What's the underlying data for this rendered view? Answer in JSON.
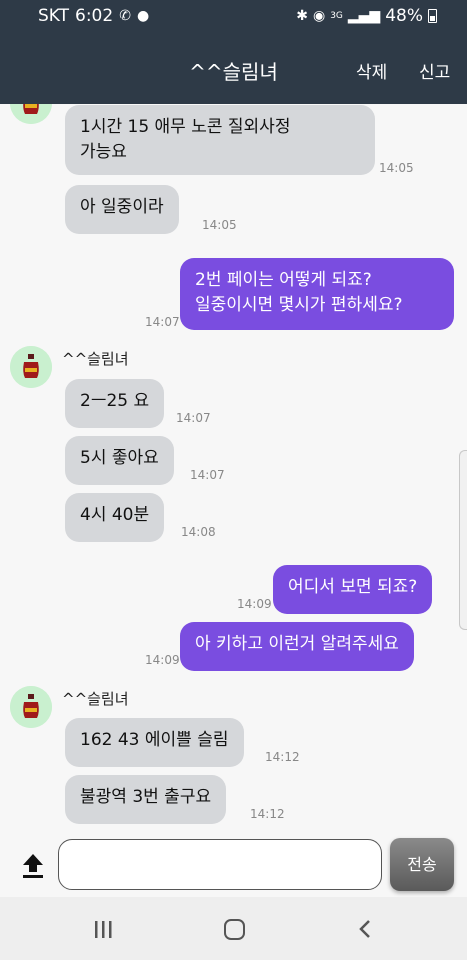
{
  "status_bar": {
    "carrier": "SKT",
    "time": "6:02",
    "network": "3G",
    "battery": "48%"
  },
  "header": {
    "title": "^^슬림녀",
    "delete_label": "삭제",
    "report_label": "신고"
  },
  "messages": [
    {
      "dir": "in",
      "text_lines": [
        "1시간 15 애무 노콘 질외사정",
        "가능요"
      ],
      "time": "14:05"
    },
    {
      "dir": "in",
      "text": "아 일중이라",
      "time": "14:05"
    },
    {
      "dir": "out",
      "text_lines": [
        "2번 페이는 어떻게 되죠?",
        "일중이시면 몇시가 편하세요?"
      ],
      "time": "14:07"
    },
    {
      "dir": "in",
      "sender": "^^슬림녀",
      "text": "2ㅡ25 요",
      "time": "14:07"
    },
    {
      "dir": "in",
      "text": "5시 좋아요",
      "time": "14:07"
    },
    {
      "dir": "in",
      "text": "4시 40분",
      "time": "14:08"
    },
    {
      "dir": "out",
      "text": "어디서 보면 되죠?",
      "time": "14:09"
    },
    {
      "dir": "out",
      "text": "아 키하고 이런거 알려주세요",
      "time": "14:09"
    },
    {
      "dir": "in",
      "sender": "^^슬림녀",
      "text": "162 43 에이쁠 슬림",
      "time": "14:12"
    },
    {
      "dir": "in",
      "text": "불광역 3번 출구요",
      "time": "14:12"
    }
  ],
  "composer": {
    "input_value": "",
    "send_label": "전송"
  },
  "colors": {
    "header_bg": "#2e3a47",
    "outgoing_bubble": "#7a4de0",
    "incoming_bubble": "#d5d7da",
    "avatar_bg": "#c9f0cf"
  },
  "icons": {
    "call": "phone-icon",
    "chat": "chat-bubble-icon",
    "bluetooth": "bluetooth-icon",
    "location": "location-icon",
    "signal": "signal-icon",
    "battery": "battery-icon",
    "avatar": "vase-avatar-icon",
    "upload": "upload-icon"
  }
}
